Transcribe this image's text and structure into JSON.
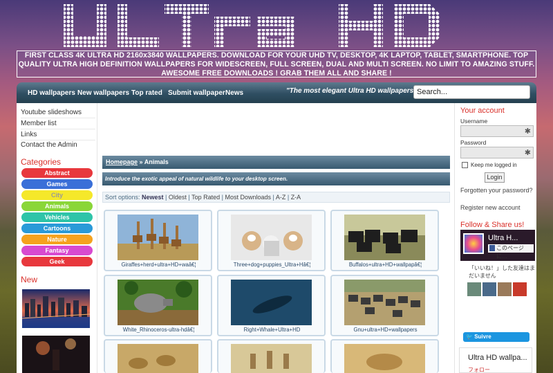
{
  "site": {
    "logo_text": "ULTRA HD",
    "banner": "FIRST CLASS 4K ULTRA HD 2160x3840 WALLPAPERS. DOWNLOAD FOR YOUR UHD TV, DESKTOP, 4K LAPTOP, TABLET, SMARTPHONE. TOP QUALITY ULTRA HIGH DEFINITION WALLPAPERS FOR WIDESCREEN, FULL SCREEN, DUAL AND MULTI SCREEN. NO LIMIT TO AMAZING STUFF. AWESOME FREE DOWNLOADS ! GRAB THEM ALL AND SHARE !"
  },
  "nav": {
    "items": [
      "HD wallpapers",
      "New wallpapers",
      "Top rated",
      "Submit wallpaper",
      "News"
    ],
    "tagline": "\"The most elegant Ultra HD wallpapers.\"",
    "search_value": "Search..."
  },
  "left": {
    "links": [
      "Youtube slideshows",
      "Member list",
      "Links",
      "Contact the Admin"
    ],
    "categories_title": "Categories",
    "categories": [
      {
        "label": "Abstract",
        "color": "#e8383d"
      },
      {
        "label": "Games",
        "color": "#3a6fd8"
      },
      {
        "label": "City",
        "color": "#f5e82a"
      },
      {
        "label": "Animals",
        "color": "#8ad638"
      },
      {
        "label": "Vehicles",
        "color": "#2ec4a8"
      },
      {
        "label": "Cartoons",
        "color": "#2a9ad8"
      },
      {
        "label": "Nature",
        "color": "#f5a21e"
      },
      {
        "label": "Fantasy",
        "color": "#d84ad0"
      },
      {
        "label": "Geek",
        "color": "#e8383d"
      }
    ],
    "new_title": "New"
  },
  "main": {
    "breadcrumb_home": "Homepage",
    "breadcrumb_sep": " » ",
    "breadcrumb_current": "Animals",
    "intro": "Introduce the exotic appeal of natural wildlife to your desktop screen.",
    "sort_label": "Sort options: ",
    "sort_options": [
      "Newest",
      "Oldest",
      "Top Rated",
      "Most Downloads",
      "A-Z",
      "Z-A"
    ],
    "cards": [
      "Giraffes+herd+ultra+HD+waâ€¦",
      "Three+dog+puppies_Ultra+Hâ€¦",
      "Buffalos+ultra+HD+wallpapâ€¦",
      "White_Rhinoceros-ultra-hdâ€¦",
      "Right+Whale+Ultra+HD",
      "Gnu+ultra+HD+wallpapers",
      "",
      "",
      ""
    ]
  },
  "right": {
    "account_title": "Your account",
    "username_label": "Username",
    "password_label": "Password",
    "keep_label": "Keep me logged in",
    "login_label": "Login",
    "forgot_label": "Forgotten your password?",
    "register_label": "Register new account",
    "follow_title": "Follow & Share us!",
    "fb_page_name": "Ultra H...",
    "fb_like_text": "このページに…",
    "fb_friends_text": "「いいね！」した友達はまだいません",
    "twitter_label": "Suivre @UHDwallpaper",
    "uhd_box_title": "Ultra HD wallpa...",
    "uhd_box_follow": "フォロー"
  },
  "colors": {
    "accent_red": "#d9302a",
    "nav_dark": "#2f4e62",
    "link_blue": "#2a4a6a"
  }
}
